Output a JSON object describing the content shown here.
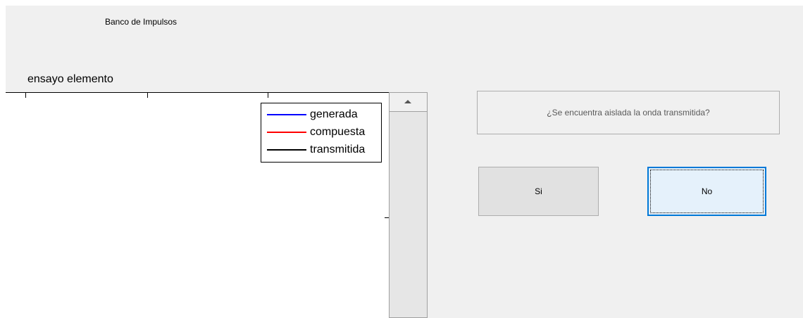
{
  "app_title": "Banco de Impulsos",
  "axes": {
    "title": "ensayo elemento",
    "legend": [
      {
        "label": "generada",
        "color": "#0000ff"
      },
      {
        "label": "compuesta",
        "color": "#ff0000"
      },
      {
        "label": "transmitida",
        "color": "#000000"
      }
    ]
  },
  "dialog": {
    "question": "¿Se encuentra aislada la onda transmitida?",
    "yes_label": "Si",
    "no_label": "No"
  },
  "colors": {
    "focus_border": "#0078d7",
    "panel_background": "#f0f0f0"
  }
}
